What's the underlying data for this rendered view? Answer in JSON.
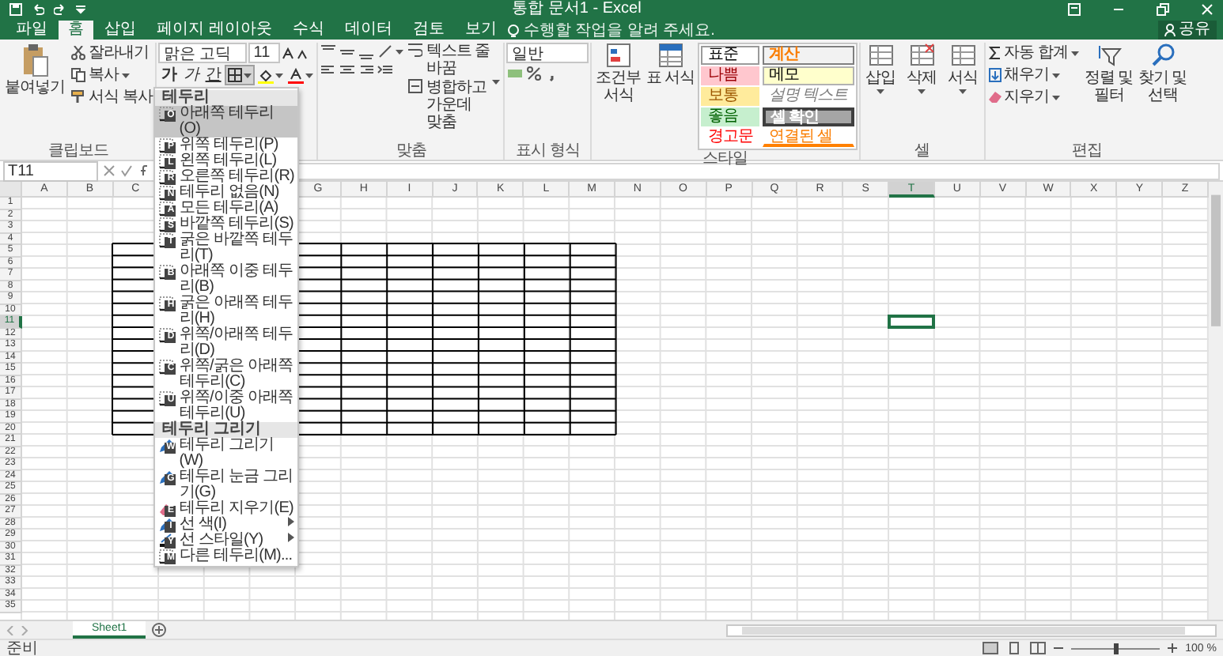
{
  "title_bar": {
    "title": "통합 문서1 - Excel"
  },
  "tabs": [
    {
      "label": "파일",
      "selected": false
    },
    {
      "label": "홈",
      "selected": true
    },
    {
      "label": "삽입",
      "selected": false
    },
    {
      "label": "페이지 레이아웃",
      "selected": false
    },
    {
      "label": "수식",
      "selected": false
    },
    {
      "label": "데이터",
      "selected": false
    },
    {
      "label": "검토",
      "selected": false
    },
    {
      "label": "보기",
      "selected": false
    }
  ],
  "tell_me": {
    "placeholder": "수행할 작업을 알려 주세요."
  },
  "share": "공유",
  "ribbon": {
    "clipboard": {
      "label": "클립보드",
      "paste": "붙여넣기",
      "cut": "잘라내기",
      "copy": "복사",
      "format_painter": "서식 복사"
    },
    "font": {
      "font_name": "맑은 고딕",
      "font_size": "11",
      "bold": "가",
      "italic": "가",
      "underline": "간"
    },
    "alignment": {
      "label": "맞춤",
      "wrap_text": "텍스트 줄 바꿈",
      "merge": "병합하고 가운데 맞춤"
    },
    "number": {
      "label": "표시 형식",
      "format": "일반"
    },
    "styles": {
      "label": "스타일",
      "conditional_formatting": "조건부 서식",
      "format_as_table": "표 서식",
      "cell_styles": [
        {
          "label": "표준",
          "kind": "normal"
        },
        {
          "label": "나쁨",
          "kind": "bad"
        },
        {
          "label": "보통",
          "kind": "neutral"
        },
        {
          "label": "좋음",
          "kind": "good"
        },
        {
          "label": "경고문",
          "kind": "warning"
        },
        {
          "label": "계산",
          "kind": "calculation"
        },
        {
          "label": "메모",
          "kind": "note"
        },
        {
          "label": "설명 텍스트",
          "kind": "explanatory"
        },
        {
          "label": "셀 확인",
          "kind": "check"
        },
        {
          "label": "연결된 셀",
          "kind": "linked"
        }
      ]
    },
    "cells": {
      "label": "셀",
      "buttons": [
        "삽입",
        "삭제",
        "서식"
      ]
    },
    "editing": {
      "label": "편집",
      "autosum": "자동 합계",
      "fill": "채우기",
      "clear": "지우기",
      "sort_filter": "정렬 및 필터",
      "find_select": "찾기 및 선택"
    }
  },
  "border_menu": {
    "items": [
      {
        "kind": "header",
        "label": "테두리",
        "selected": false
      },
      {
        "kind": "item",
        "label": "아래쪽 테두리(O)",
        "keytip": "O",
        "selected": true
      },
      {
        "kind": "item",
        "label": "위쪽 테두리(P)",
        "keytip": "P",
        "selected": false
      },
      {
        "kind": "item",
        "label": "왼쪽 테두리(L)",
        "keytip": "L",
        "selected": false
      },
      {
        "kind": "item",
        "label": "오른쪽 테두리(R)",
        "keytip": "R",
        "selected": false
      },
      {
        "kind": "item",
        "label": "테두리 없음(N)",
        "keytip": "N",
        "selected": false
      },
      {
        "kind": "item",
        "label": "모든 테두리(A)",
        "keytip": "A",
        "selected": false
      },
      {
        "kind": "item",
        "label": "바깥쪽 테두리(S)",
        "keytip": "S",
        "selected": false
      },
      {
        "kind": "item",
        "label": "굵은 바깥쪽 테두리(T)",
        "keytip": "T",
        "selected": false
      },
      {
        "kind": "item",
        "label": "아래쪽 이중 테두리(B)",
        "keytip": "B",
        "selected": false
      },
      {
        "kind": "item",
        "label": "굵은 아래쪽 테두리(H)",
        "keytip": "H",
        "selected": false
      },
      {
        "kind": "item",
        "label": "위쪽/아래쪽 테두리(D)",
        "keytip": "D",
        "selected": false
      },
      {
        "kind": "item",
        "label": "위쪽/굵은 아래쪽 테두리(C)",
        "keytip": "C",
        "selected": false
      },
      {
        "kind": "item",
        "label": "위쪽/이중 아래쪽 테두리(U)",
        "keytip": "U",
        "selected": false
      },
      {
        "kind": "header",
        "label": "테두리 그리기",
        "selected": false
      },
      {
        "kind": "item",
        "label": "테두리 그리기(W)",
        "keytip": "W",
        "selected": false
      },
      {
        "kind": "item",
        "label": "테두리 눈금 그리기(G)",
        "keytip": "G",
        "selected": false
      },
      {
        "kind": "item",
        "label": "테두리 지우기(E)",
        "keytip": "E",
        "selected": false
      },
      {
        "kind": "submenu",
        "label": "선 색(I)",
        "keytip": "I",
        "selected": false
      },
      {
        "kind": "submenu",
        "label": "선 스타일(Y)",
        "keytip": "Y",
        "selected": false
      },
      {
        "kind": "item",
        "label": "다른 테두리(M)...",
        "keytip": "M",
        "selected": false
      }
    ]
  },
  "formula_bar": {
    "name_box": "T11"
  },
  "sheet": {
    "columns": [
      {
        "label": "A",
        "selected": false
      },
      {
        "label": "B",
        "selected": false
      },
      {
        "label": "C",
        "selected": false
      },
      {},
      {},
      {},
      {
        "label": "G",
        "selected": false
      },
      {
        "label": "H",
        "selected": false
      },
      {
        "label": "I",
        "selected": false
      },
      {
        "label": "J",
        "selected": false
      },
      {
        "label": "K",
        "selected": false
      },
      {
        "label": "L",
        "selected": false
      },
      {
        "label": "M",
        "selected": false
      },
      {
        "label": "N",
        "selected": false
      },
      {
        "label": "O",
        "selected": false
      },
      {
        "label": "P",
        "selected": false
      },
      {
        "label": "Q",
        "selected": false
      },
      {
        "label": "R",
        "selected": false
      },
      {
        "label": "S",
        "selected": false
      },
      {
        "label": "T",
        "selected": true
      },
      {
        "label": "U",
        "selected": false
      },
      {
        "label": "V",
        "selected": false
      },
      {
        "label": "W",
        "selected": false
      },
      {
        "label": "X",
        "selected": false
      },
      {
        "label": "Y",
        "selected": false
      },
      {
        "label": "Z",
        "selected": false
      }
    ],
    "rows": [
      {
        "label": "1",
        "selected": false
      },
      {
        "label": "2",
        "selected": false
      },
      {
        "label": "3",
        "selected": false
      },
      {
        "label": "4",
        "selected": false
      },
      {
        "label": "5",
        "selected": false
      },
      {
        "label": "6",
        "selected": false
      },
      {
        "label": "7",
        "selected": false
      },
      {
        "label": "8",
        "selected": false
      },
      {
        "label": "9",
        "selected": false
      },
      {
        "label": "10",
        "selected": false
      },
      {
        "label": "11",
        "selected": true
      },
      {
        "label": "12",
        "selected": false
      },
      {
        "label": "13",
        "selected": false
      },
      {
        "label": "14",
        "selected": false
      },
      {
        "label": "15",
        "selected": false
      },
      {
        "label": "16",
        "selected": false
      },
      {
        "label": "17",
        "selected": false
      },
      {
        "label": "18",
        "selected": false
      },
      {
        "label": "19",
        "selected": false
      },
      {
        "label": "20",
        "selected": false
      },
      {
        "label": "21",
        "selected": false
      },
      {
        "label": "22",
        "selected": false
      },
      {
        "label": "23",
        "selected": false
      },
      {
        "label": "24",
        "selected": false
      },
      {
        "label": "25",
        "selected": false
      },
      {
        "label": "26",
        "selected": false
      },
      {
        "label": "27",
        "selected": false
      },
      {
        "label": "28",
        "selected": false
      },
      {
        "label": "29",
        "selected": false
      },
      {
        "label": "30",
        "selected": false
      },
      {
        "label": "31",
        "selected": false
      },
      {
        "label": "32",
        "selected": false
      },
      {
        "label": "33",
        "selected": false
      },
      {
        "label": "34",
        "selected": false
      },
      {
        "label": "35",
        "selected": false
      }
    ]
  },
  "sheet_tabs": [
    {
      "label": "Sheet1",
      "selected": true
    }
  ],
  "status_bar": {
    "status": "준비",
    "zoom": "100 %",
    "zoom_slider": {
      "level": 0.5
    }
  }
}
